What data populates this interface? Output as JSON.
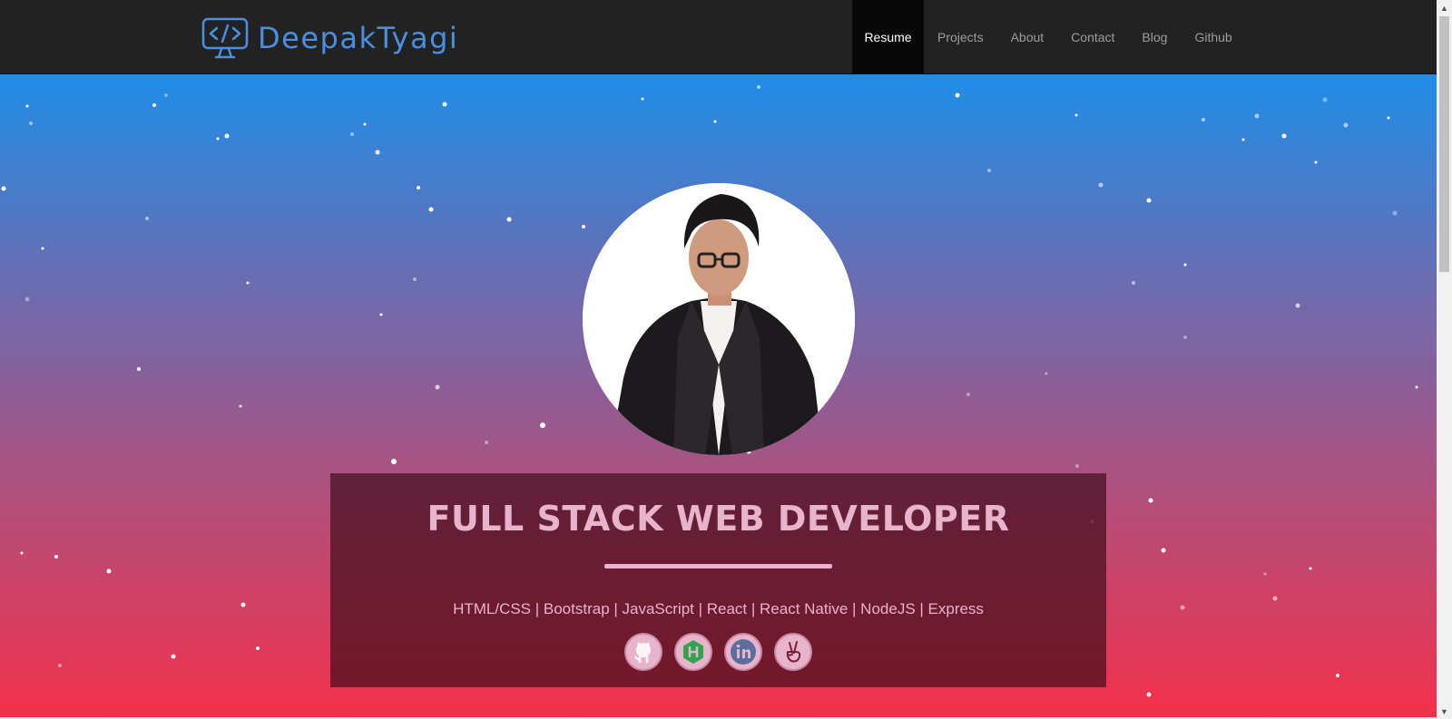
{
  "brand": {
    "name": "DeepakTyagi",
    "icon": "code-monitor-icon",
    "color": "#4a90e2"
  },
  "nav": {
    "items": [
      {
        "label": "Resume",
        "active": true
      },
      {
        "label": "Projects",
        "active": false
      },
      {
        "label": "About",
        "active": false
      },
      {
        "label": "Contact",
        "active": false
      },
      {
        "label": "Blog",
        "active": false
      },
      {
        "label": "Github",
        "active": false
      }
    ]
  },
  "hero": {
    "headline": "FULL STACK WEB DEVELOPER",
    "skills": "HTML/CSS | Bootstrap | JavaScript | React | React Native | NodeJS | Express",
    "gradient": [
      "#1f8de8",
      "#6f6aad",
      "#b0507c",
      "#f3304b"
    ],
    "accent": "#e8b4cb"
  },
  "socials": [
    {
      "icon": "github-icon"
    },
    {
      "icon": "hackerrank-icon"
    },
    {
      "icon": "linkedin-icon"
    },
    {
      "icon": "angellist-icon"
    }
  ]
}
